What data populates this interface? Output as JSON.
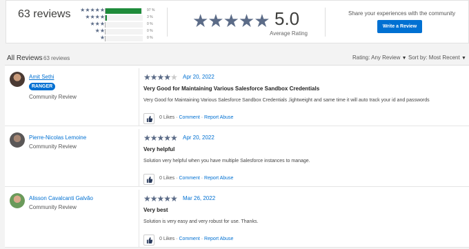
{
  "summary": {
    "total_reviews": "63 reviews",
    "distribution": [
      {
        "stars": 5,
        "stars_glyph": "★★★★★",
        "percent": "97 %",
        "fill": 0.97
      },
      {
        "stars": 4,
        "stars_glyph": "★★★★",
        "percent": "3 %",
        "fill": 0.03
      },
      {
        "stars": 3,
        "stars_glyph": "★★★",
        "percent": "0 %",
        "fill": 0
      },
      {
        "stars": 2,
        "stars_glyph": "★★",
        "percent": "0 %",
        "fill": 0
      },
      {
        "stars": 1,
        "stars_glyph": "★",
        "percent": "0 %",
        "fill": 0
      }
    ],
    "average_stars": "★★★★★",
    "average": "5.0",
    "average_label": "Average Rating",
    "share_text": "Share your experiences with the community",
    "write_review_label": "Write a Review"
  },
  "list": {
    "title": "All Reviews",
    "count": "63 reviews",
    "rating_filter": "Rating: Any Review",
    "sort": "Sort by: Most Recent"
  },
  "reviews": [
    {
      "name": "Amit Sethi",
      "badge": "RANGER",
      "role": "Community Review",
      "rating": 4,
      "stars_filled": "★★★★",
      "stars_empty": "★",
      "date": "Apr 20, 2022",
      "title": "Very Good for Maintaining Various Salesforce Sandbox Credentials",
      "body": "Very Good for Maintaining Various Salesforce Sandbox Credentials ,lightweight and same time it will auto track your id and passwords",
      "likes": "0 Likes",
      "comment": "Comment",
      "report": "Report Abuse"
    },
    {
      "name": "Pierre-Nicolas Lemoine",
      "role": "Community Review",
      "rating": 5,
      "stars_filled": "★★★★★",
      "stars_empty": "",
      "date": "Apr 20, 2022",
      "title": "Very helpful",
      "body": "Solution very helpful when you have multiple Salesforce instances to manage.",
      "likes": "0 Likes",
      "comment": "Comment",
      "report": "Report Abuse"
    },
    {
      "name": "Alisson Cavalcanti Galvão",
      "role": "Community Review",
      "rating": 5,
      "stars_filled": "★★★★★",
      "stars_empty": "",
      "date": "Mar 26, 2022",
      "title": "Very best",
      "body": "Solution is very easy and very robust for use. Thanks.",
      "likes": "0 Likes",
      "comment": "Comment",
      "report": "Report Abuse"
    }
  ],
  "separator": "·"
}
